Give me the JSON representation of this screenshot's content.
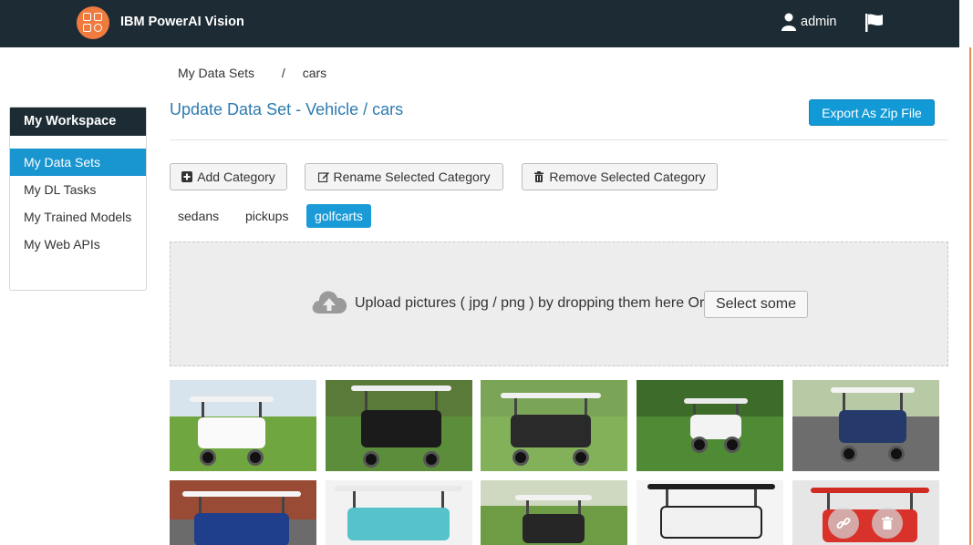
{
  "header": {
    "app_title": "IBM PowerAI Vision",
    "user_name": "admin",
    "user_icon": "user-icon",
    "flag_icon": "flag-icon",
    "bg_color": "#1d2c34",
    "logo_color": "#f07b3f"
  },
  "sidebar": {
    "title": "My Workspace",
    "items": [
      {
        "label": "My Data Sets",
        "active": true
      },
      {
        "label": "My DL Tasks",
        "active": false
      },
      {
        "label": "My Trained Models",
        "active": false
      },
      {
        "label": "My Web APIs",
        "active": false
      }
    ]
  },
  "breadcrumb": {
    "items": [
      "My Data Sets",
      "cars"
    ],
    "separator": "/"
  },
  "main": {
    "page_title": "Update Data Set - Vehicle / cars",
    "export_label": "Export As Zip File",
    "toolbar": {
      "add_label": "Add Category",
      "rename_label": "Rename Selected Category",
      "remove_label": "Remove Selected Category"
    },
    "categories": [
      {
        "label": "sedans",
        "active": false
      },
      {
        "label": "pickups",
        "active": false
      },
      {
        "label": "golfcarts",
        "active": true
      }
    ],
    "upload": {
      "text": "Upload pictures ( jpg / png ) by dropping them here Or",
      "select_label": "Select some",
      "icon": "cloud-upload-icon"
    },
    "accent_color": "#1a9ad6",
    "thumbnails": [
      {
        "kind": "golf-cart-photo"
      },
      {
        "kind": "golf-cart-photo"
      },
      {
        "kind": "golf-cart-photo"
      },
      {
        "kind": "golf-cart-photo"
      },
      {
        "kind": "golf-cart-photo"
      },
      {
        "kind": "golf-cart-photo"
      },
      {
        "kind": "golf-cart-photo"
      },
      {
        "kind": "golf-cart-photo"
      },
      {
        "kind": "golf-cart-photo"
      },
      {
        "kind": "golf-cart-photo"
      }
    ],
    "thumbnail_overlay_icons": [
      "link-icon",
      "trash-icon"
    ]
  }
}
